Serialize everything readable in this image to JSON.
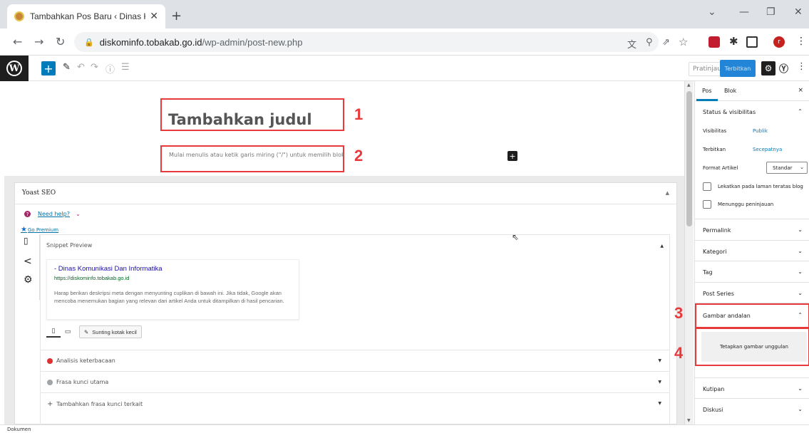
{
  "browser": {
    "tab_title": "Tambahkan Pos Baru ‹ Dinas Kor",
    "tab_close": "✕",
    "new_tab": "+",
    "url_host": "diskominfo.tobakab.go.id",
    "url_path": "/wp-admin/post-new.php",
    "profile_initial": "r"
  },
  "toolbar": {
    "add_block": "+",
    "preview_label": "Pratinjau",
    "publish_label": "Terbitkan"
  },
  "editor": {
    "title_placeholder": "Tambahkan judul",
    "body_placeholder": "Mulai menulis atau ketik garis miring (\"/\") untuk memilih blok",
    "inserter": "+"
  },
  "markers": [
    "1",
    "2",
    "3",
    "4"
  ],
  "yoast": {
    "title": "Yoast SEO",
    "need_help": "Need help?",
    "go_premium": "Go Premium",
    "snippet_preview_label": "Snippet Preview",
    "serp_title": "- Dinas Komunikasi Dan Informatika",
    "serp_url": "https://diskominfo.tobakab.go.id",
    "serp_description": "Harap berikan deskripsi meta dengan menyunting cuplikan di bawah ini. Jika tidak, Google akan mencoba menemukan bagian yang relevan dari artikel Anda untuk ditampilkan di hasil pencarian.",
    "edit_snippet_label": "Sunting kotak kecil",
    "sections": [
      {
        "label": "Analisis keterbacaan",
        "indicator": "#dc3232"
      },
      {
        "label": "Frasa kunci utama",
        "indicator": "#a0a5aa"
      },
      {
        "label": "Tambahkan frasa kunci terkait",
        "indicator": "plus"
      }
    ]
  },
  "sidebar": {
    "tab_post": "Pos",
    "tab_block": "Blok",
    "close": "×",
    "status_title": "Status & visibilitas",
    "visibility_label": "Visibilitas",
    "visibility_value": "Publik",
    "publish_label": "Terbitkan",
    "publish_value": "Secepatnya",
    "format_label": "Format Artikel",
    "format_value": "Standar",
    "sticky_label": "Lekatkan pada laman teratas blog",
    "pending_label": "Menunggu peninjauan",
    "sections": [
      "Permalink",
      "Kategori",
      "Tag",
      "Post Series",
      "Gambar andalan"
    ],
    "featured_button": "Tetapkan gambar unggulan",
    "excerpt": "Kutipan",
    "discussion": "Diskusi"
  },
  "status_bar": {
    "breadcrumb": "Dokumen"
  },
  "colors": {
    "accent": "#007cba",
    "annotation": "#e8393b",
    "yoast_brand": "#a4286a"
  }
}
